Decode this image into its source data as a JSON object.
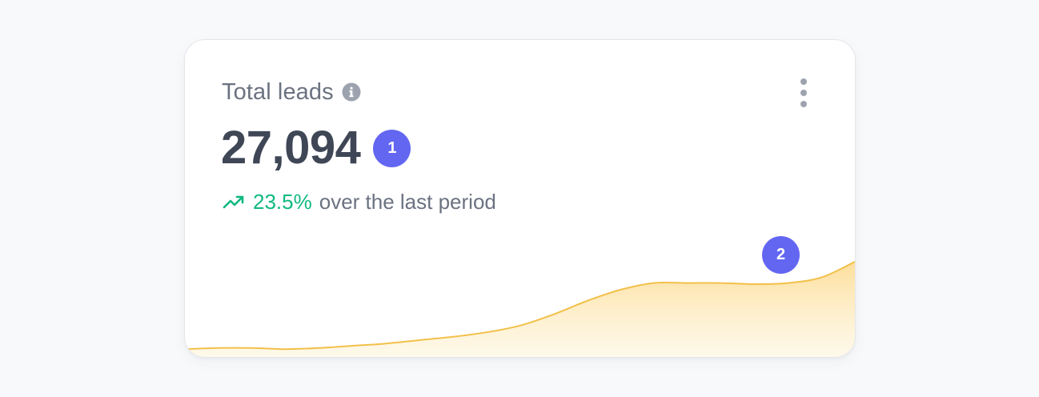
{
  "card": {
    "title": "Total leads",
    "value": "27,094",
    "change_value": "23.5%",
    "change_label": "over the last period"
  },
  "icons": {
    "info": "info-icon",
    "menu": "more-vertical-icon",
    "trend": "trending-up-icon"
  },
  "badges": [
    "1",
    "2"
  ],
  "colors": {
    "accent": "#6366f1",
    "positive": "#10b981",
    "chart_line": "#f2c04a",
    "chart_fill": "#fde6a8"
  },
  "chart_data": {
    "type": "area",
    "values": [
      0.07,
      0.08,
      0.08,
      0.07,
      0.08,
      0.1,
      0.12,
      0.15,
      0.18,
      0.22,
      0.28,
      0.38,
      0.5,
      0.6,
      0.66,
      0.66,
      0.66,
      0.65,
      0.66,
      0.71,
      0.85
    ],
    "title": "",
    "xlabel": "",
    "ylabel": "",
    "grid": false
  }
}
